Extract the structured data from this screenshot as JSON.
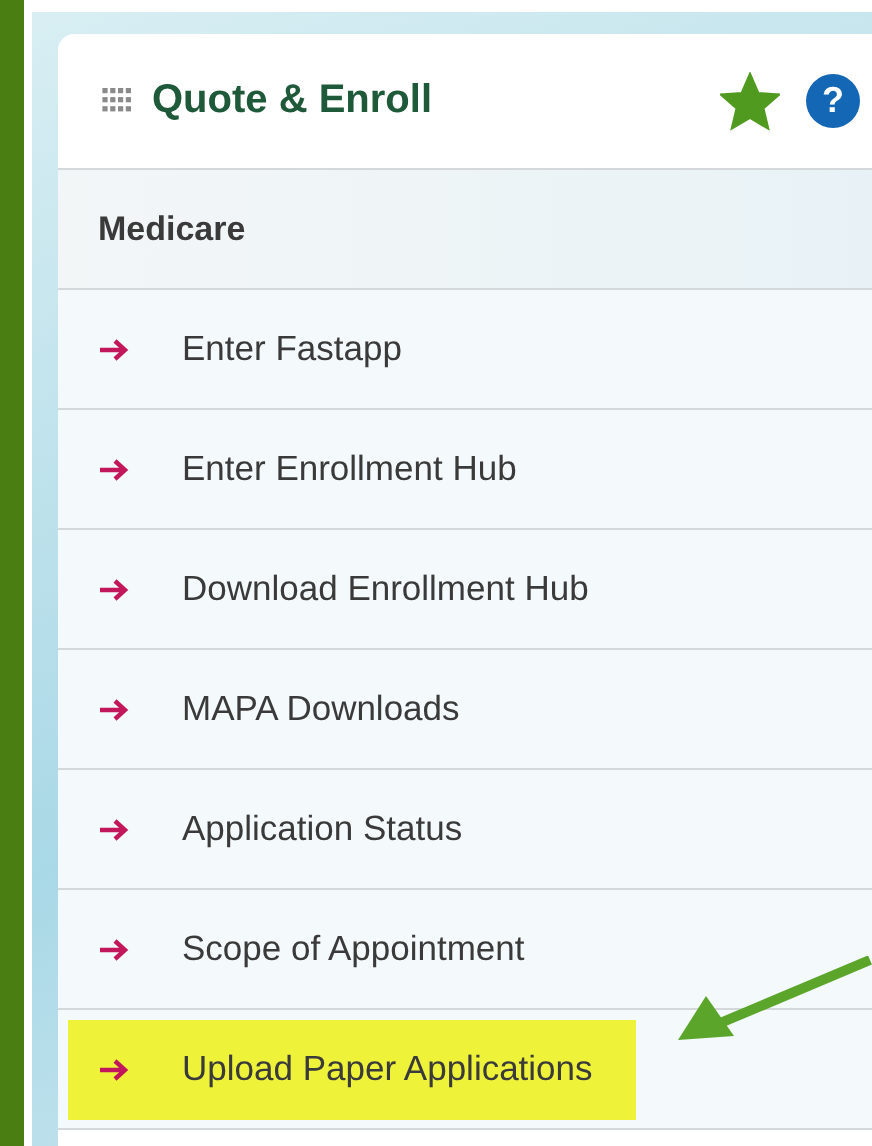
{
  "panel": {
    "title": "Quote & Enroll",
    "favorite": true,
    "help": "?"
  },
  "section": {
    "title": "Medicare"
  },
  "items": [
    {
      "label": "Enter Fastapp",
      "highlighted": false
    },
    {
      "label": "Enter Enrollment Hub",
      "highlighted": false
    },
    {
      "label": "Download Enrollment Hub",
      "highlighted": false
    },
    {
      "label": "MAPA Downloads",
      "highlighted": false
    },
    {
      "label": "Application Status",
      "highlighted": false
    },
    {
      "label": "Scope of Appointment",
      "highlighted": false
    },
    {
      "label": "Upload Paper Applications",
      "highlighted": true
    }
  ]
}
